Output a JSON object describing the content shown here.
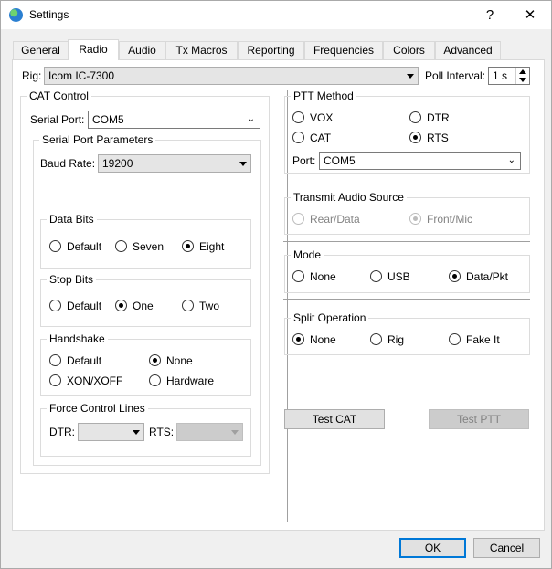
{
  "window": {
    "title": "Settings",
    "help_glyph": "?",
    "close_glyph": "✕"
  },
  "tabs": [
    {
      "label": "General"
    },
    {
      "label": "Radio"
    },
    {
      "label": "Audio"
    },
    {
      "label": "Tx Macros"
    },
    {
      "label": "Reporting"
    },
    {
      "label": "Frequencies"
    },
    {
      "label": "Colors"
    },
    {
      "label": "Advanced"
    }
  ],
  "active_tab": "Radio",
  "rig": {
    "label": "Rig:",
    "value": "Icom IC-7300",
    "poll_label": "Poll Interval:",
    "poll_value": "1 s"
  },
  "cat": {
    "title": "CAT Control",
    "serial_port_label": "Serial Port:",
    "serial_port_value": "COM5",
    "params_title": "Serial Port Parameters",
    "baud_label": "Baud Rate:",
    "baud_value": "19200",
    "data_bits": {
      "title": "Data Bits",
      "options": [
        "Default",
        "Seven",
        "Eight"
      ],
      "selected": "Eight"
    },
    "stop_bits": {
      "title": "Stop Bits",
      "options": [
        "Default",
        "One",
        "Two"
      ],
      "selected": "One"
    },
    "handshake": {
      "title": "Handshake",
      "options": [
        "Default",
        "None",
        "XON/XOFF",
        "Hardware"
      ],
      "selected": "None"
    },
    "force": {
      "title": "Force Control Lines",
      "dtr_label": "DTR:",
      "rts_label": "RTS:"
    }
  },
  "ptt": {
    "title": "PTT Method",
    "options": [
      "VOX",
      "DTR",
      "CAT",
      "RTS"
    ],
    "selected": "RTS",
    "port_label": "Port:",
    "port_value": "COM5"
  },
  "tx_audio": {
    "title": "Transmit Audio Source",
    "options": [
      "Rear/Data",
      "Front/Mic"
    ],
    "selected": "Front/Mic"
  },
  "mode": {
    "title": "Mode",
    "options": [
      "None",
      "USB",
      "Data/Pkt"
    ],
    "selected": "Data/Pkt"
  },
  "split": {
    "title": "Split Operation",
    "options": [
      "None",
      "Rig",
      "Fake It"
    ],
    "selected": "None"
  },
  "buttons": {
    "test_cat": "Test CAT",
    "test_ptt": "Test PTT",
    "ok": "OK",
    "cancel": "Cancel"
  }
}
